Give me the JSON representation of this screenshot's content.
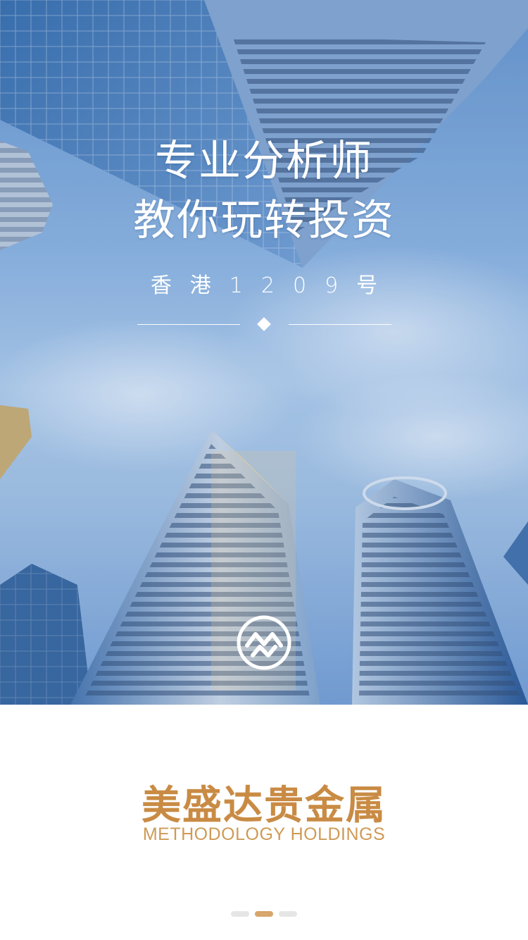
{
  "hero": {
    "headline_line1": "专业分析师",
    "headline_line2": "教你玩转投资",
    "address": "香港1209号",
    "logo_icon": "brand-emblem-icon"
  },
  "brand": {
    "name_cn": "美盛达贵金属",
    "name_en": "METHODOLOGY HOLDINGS",
    "color": "#c98b44"
  },
  "pager": {
    "total": 3,
    "active_index": 1,
    "active_color": "#d8a56a",
    "inactive_color": "#e6e6e6"
  }
}
